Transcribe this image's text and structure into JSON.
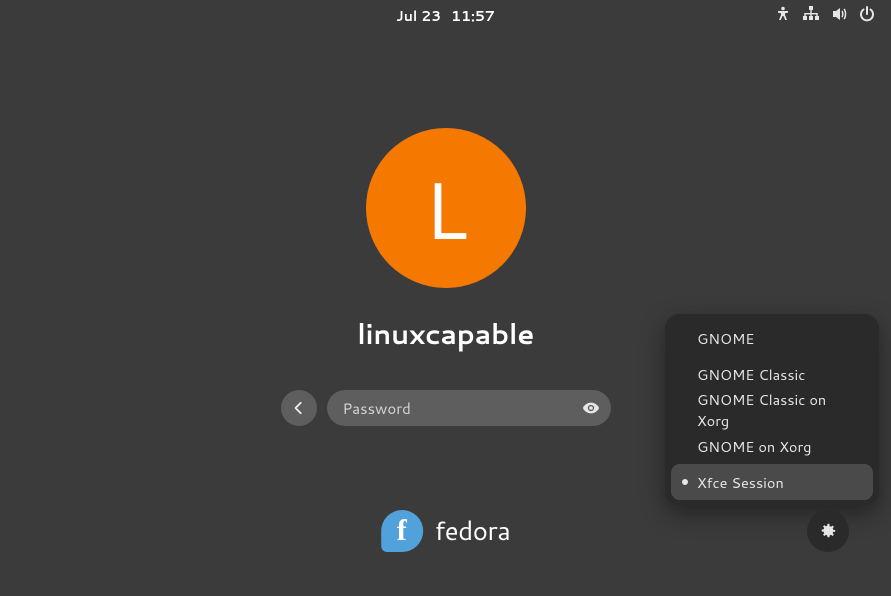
{
  "topbar": {
    "date": "Jul 23",
    "time": "11:57"
  },
  "user": {
    "avatar_letter": "L",
    "avatar_color": "#f57900",
    "name": "linuxcapable"
  },
  "password": {
    "placeholder": "Password",
    "value": ""
  },
  "sessions": {
    "items": [
      {
        "label": "GNOME",
        "selected": false
      },
      {
        "label": "GNOME Classic",
        "selected": false
      },
      {
        "label": "GNOME Classic on Xorg",
        "selected": false
      },
      {
        "label": "GNOME on Xorg",
        "selected": false
      },
      {
        "label": "Xfce Session",
        "selected": true
      }
    ]
  },
  "distro": {
    "name": "fedora"
  }
}
